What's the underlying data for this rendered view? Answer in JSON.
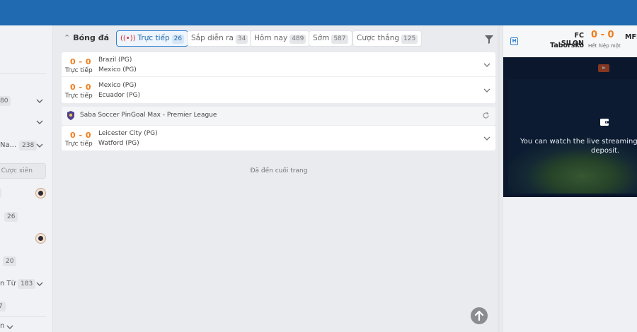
{
  "sidebar": {
    "badges": [
      "80",
      "238",
      "26",
      "20",
      "183"
    ],
    "texts": [
      "Na...",
      "n Từ",
      "n"
    ],
    "truncated_digit": "7",
    "parlay_button": "Cược xiên"
  },
  "main": {
    "sport_title": "Bóng đá",
    "tabs": [
      {
        "label": "Trực tiếp",
        "count": "26",
        "active": true
      },
      {
        "label": "Sắp diễn ra",
        "count": "34"
      },
      {
        "label": "Hôm nay",
        "count": "489"
      },
      {
        "label": "Sớm",
        "count": "587"
      },
      {
        "label": "Cược thắng",
        "count": "125"
      }
    ],
    "group1": [
      {
        "score": "0 - 0",
        "status": "Trực tiếp",
        "home": "Brazil (PG)",
        "away": "Mexico (PG)"
      },
      {
        "score": "0 - 0",
        "status": "Trực tiếp",
        "home": "Mexico (PG)",
        "away": "Ecuador (PG)"
      }
    ],
    "league": {
      "name": "Saba Soccer PinGoal Max - Premier League",
      "matches": [
        {
          "score": "0 - 0",
          "status": "Trực tiếp",
          "home": "Leicester City (PG)",
          "away": "Watford (PG)"
        }
      ]
    },
    "end_of_page": "Đã đến cuối trang"
  },
  "right_panel": {
    "h_badge": "H",
    "home_team_line1": "FC SILON",
    "home_team_line2": "Taborsko",
    "score": "0 - 0",
    "away_team": "MFK",
    "period": "Hết hiệp một",
    "video_message": "You can watch the live streaming",
    "video_message_line2": "deposit."
  },
  "colors": {
    "topbar": "#1f6ab0",
    "score_orange": "#f27b1a",
    "active_tab": "#2f80d1",
    "live_red": "#e02020"
  }
}
